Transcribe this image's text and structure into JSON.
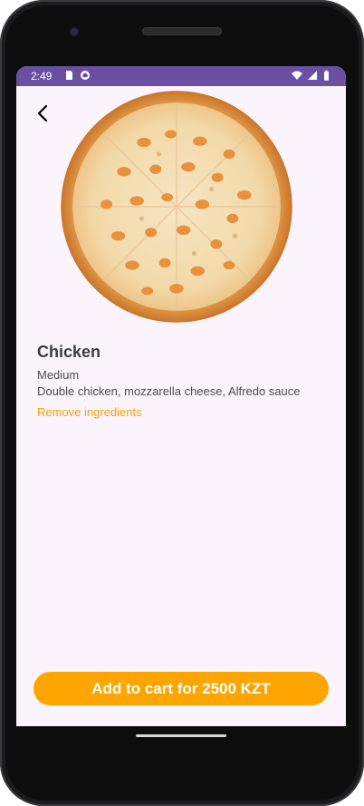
{
  "status_bar": {
    "time": "2:49",
    "left_icons": [
      "sd-card-icon",
      "notification-icon"
    ],
    "right_icons": [
      "wifi-icon",
      "cell-signal-icon",
      "battery-icon"
    ],
    "color": "#6a4fa3"
  },
  "header": {
    "back_icon": "arrow-back-icon"
  },
  "product": {
    "image_icon": "pizza-image",
    "name": "Chicken",
    "size": "Medium",
    "description": "Double chicken, mozzarella cheese, Alfredo sauce",
    "remove_label": "Remove ingredients"
  },
  "cart": {
    "button_label": "Add to cart for 2500 KZT"
  },
  "colors": {
    "accent": "#ffa500",
    "background": "#fcf4fc",
    "status_bar": "#6a4fa3"
  }
}
